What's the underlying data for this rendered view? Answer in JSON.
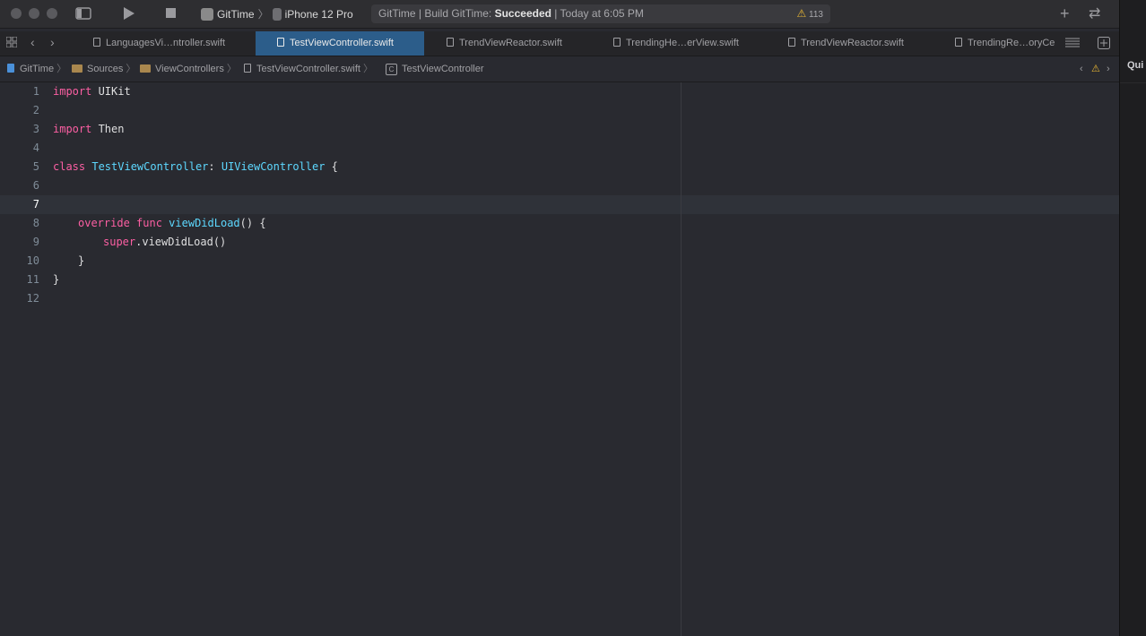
{
  "toolbar": {
    "scheme": "GitTime",
    "device": "iPhone 12 Pro",
    "status_prefix": "GitTime | Build GitTime: ",
    "status_result": "Succeeded",
    "status_time": " | Today at 6:05 PM",
    "warning_count": "113"
  },
  "tabs": [
    {
      "label": "LanguagesVi…ntroller.swift"
    },
    {
      "label": "TestViewController.swift"
    },
    {
      "label": "TrendViewReactor.swift"
    },
    {
      "label": "TrendingHe…erView.swift"
    },
    {
      "label": "TrendViewReactor.swift"
    },
    {
      "label": "TrendingRe…oryCe"
    }
  ],
  "breadcrumb": [
    "GitTime",
    "Sources",
    "ViewControllers",
    "TestViewController.swift",
    "TestViewController"
  ],
  "editor": {
    "line_numbers": [
      "1",
      "2",
      "3",
      "4",
      "5",
      "6",
      "7",
      "8",
      "9",
      "10",
      "11",
      "12"
    ],
    "current_line": "7"
  },
  "right_panel": {
    "label": "Qui"
  }
}
